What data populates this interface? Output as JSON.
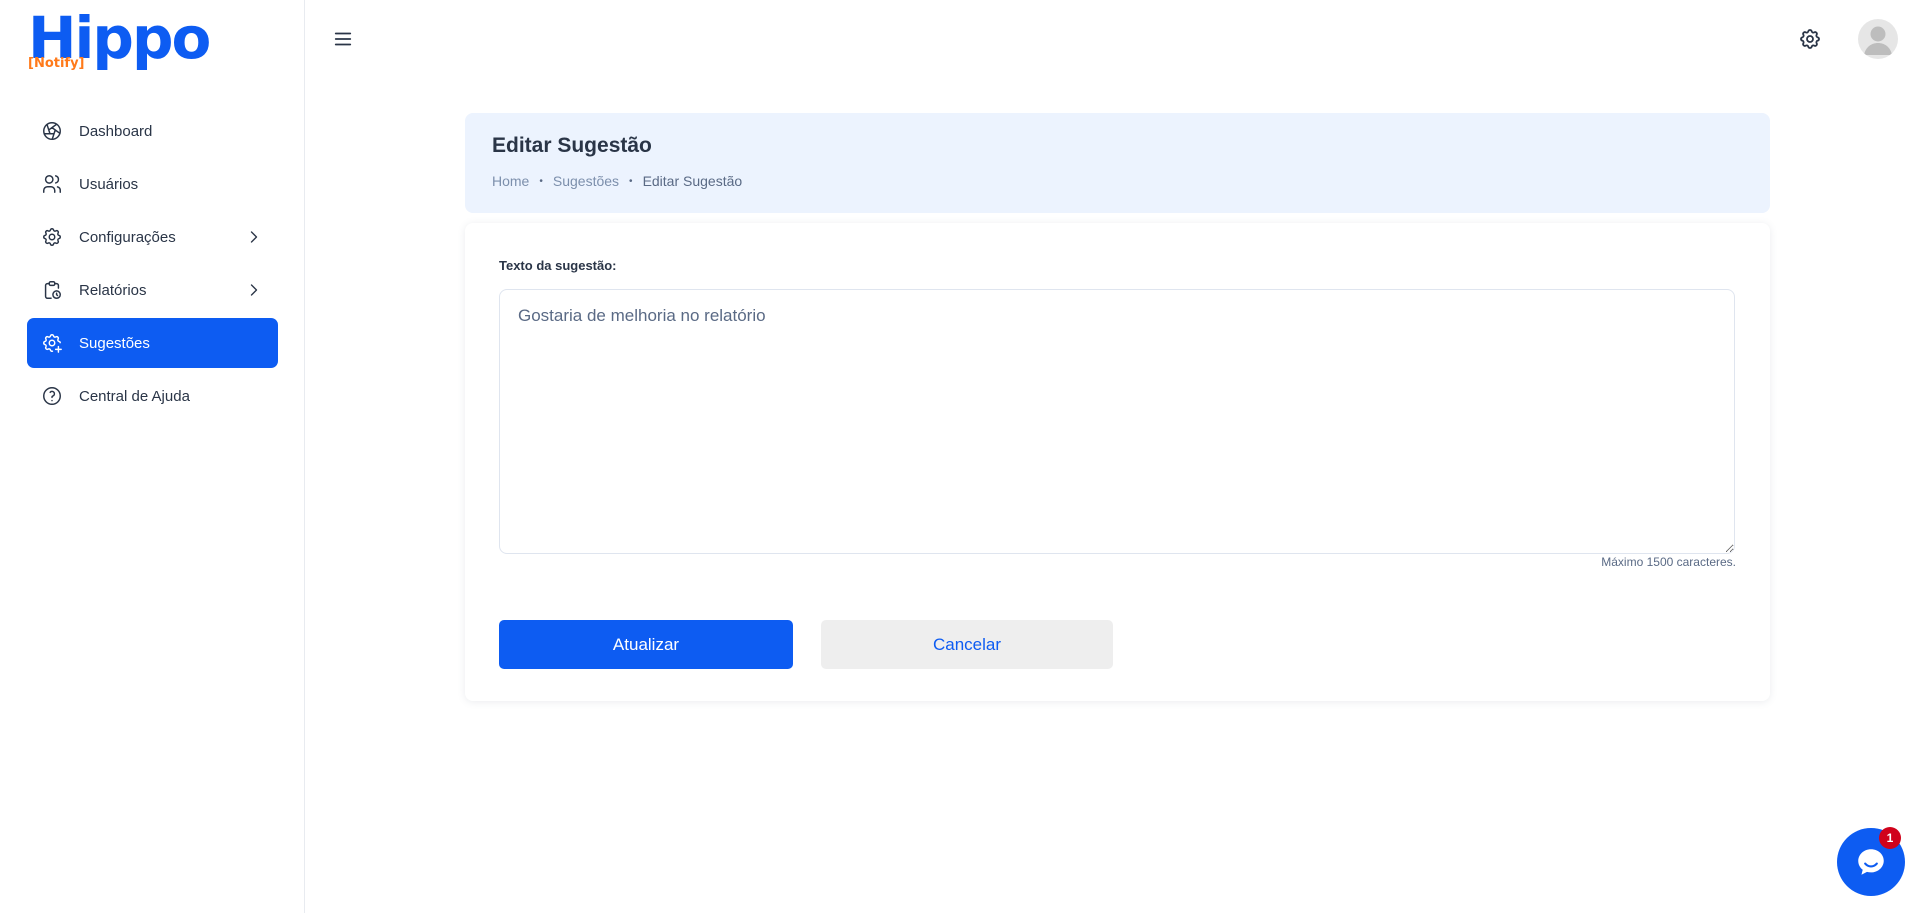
{
  "brand": {
    "name": "Hippo",
    "tagline": "[Notify]",
    "primary_color": "#0d5cf2",
    "accent_color": "#ff7a1a"
  },
  "sidebar": {
    "items": [
      {
        "label": "Dashboard",
        "icon": "aperture-icon",
        "active": false,
        "has_submenu": false
      },
      {
        "label": "Usuários",
        "icon": "users-icon",
        "active": false,
        "has_submenu": false
      },
      {
        "label": "Configurações",
        "icon": "gear-icon",
        "active": false,
        "has_submenu": true
      },
      {
        "label": "Relatórios",
        "icon": "clipboard-clock-icon",
        "active": false,
        "has_submenu": true
      },
      {
        "label": "Sugestões",
        "icon": "gear-plus-icon",
        "active": true,
        "has_submenu": false
      },
      {
        "label": "Central de Ajuda",
        "icon": "help-circle-icon",
        "active": false,
        "has_submenu": false
      }
    ]
  },
  "topbar": {
    "menu_icon": "hamburger-icon",
    "settings_icon": "gear-icon",
    "avatar_icon": "user-avatar-icon"
  },
  "header": {
    "title": "Editar Sugestão",
    "breadcrumb": [
      "Home",
      "Sugestões",
      "Editar Sugestão"
    ],
    "separator": "•"
  },
  "form": {
    "label": "Texto da sugestão:",
    "value": "Gostaria de melhoria no relatório",
    "hint": "Máximo 1500 caracteres.",
    "submit_label": "Atualizar",
    "cancel_label": "Cancelar"
  },
  "chat": {
    "icon": "chat-bubble-icon",
    "badge_count": "1",
    "badge_color": "#d0021b"
  }
}
